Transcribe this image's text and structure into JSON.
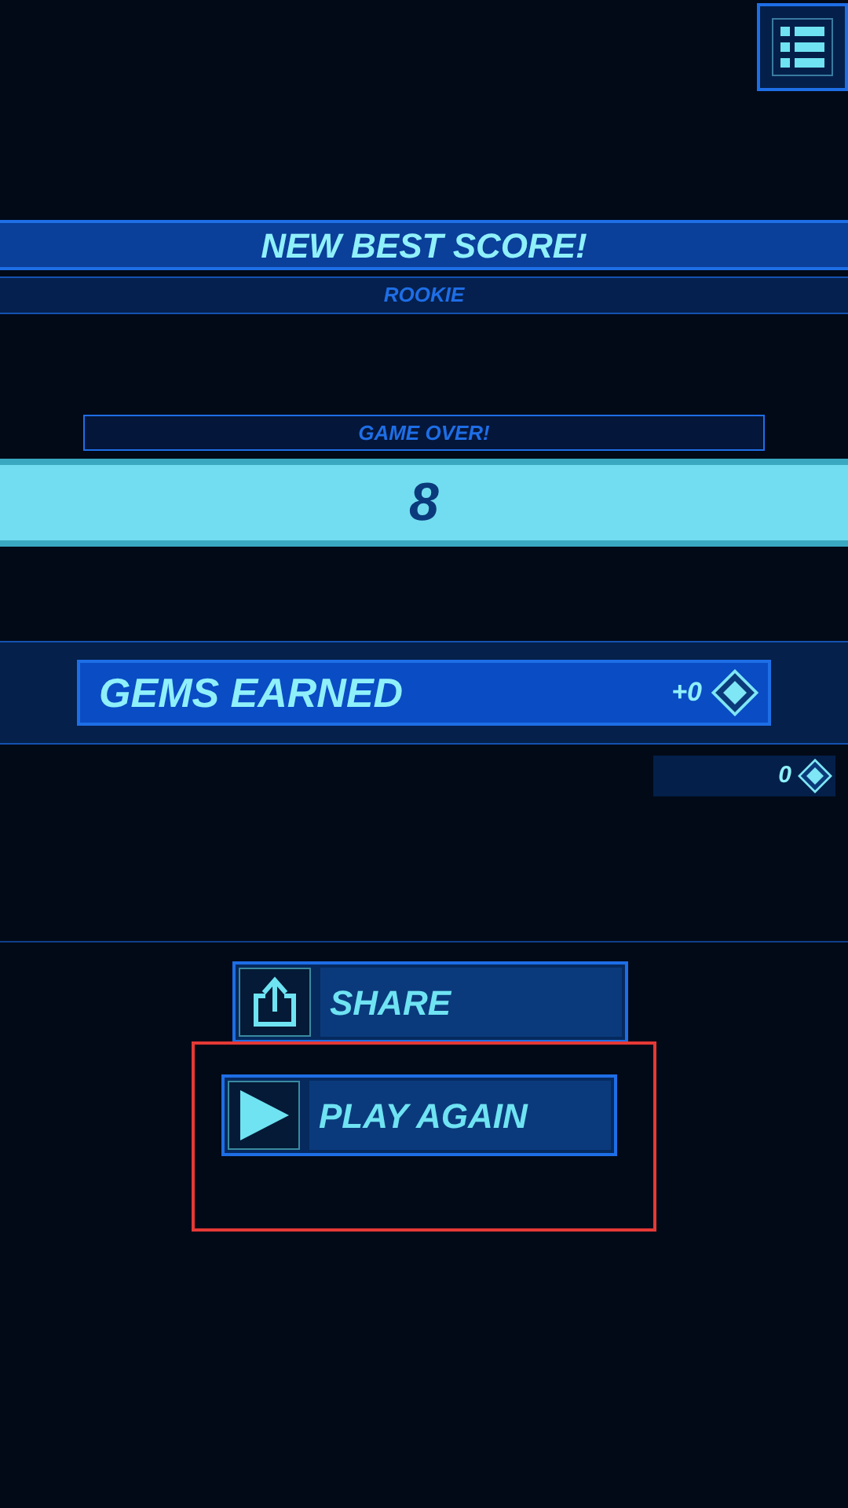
{
  "banner": {
    "title": "NEW BEST SCORE!",
    "rank": "ROOKIE"
  },
  "result": {
    "label": "GAME OVER!",
    "score": "8"
  },
  "gems": {
    "label": "GEMS EARNED",
    "earned": "+0",
    "total": "0"
  },
  "buttons": [
    {
      "label": "SHARE",
      "kind": "share",
      "highlighted": false
    },
    {
      "label": "PLAY AGAIN",
      "kind": "play",
      "highlighted": true
    }
  ]
}
